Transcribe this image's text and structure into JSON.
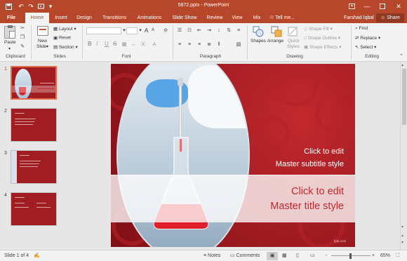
{
  "app": {
    "document_title": "5872.pptx - PowerPoint"
  },
  "tabs": [
    {
      "label": "File"
    },
    {
      "label": "Home"
    },
    {
      "label": "Insert"
    },
    {
      "label": "Design"
    },
    {
      "label": "Transitions"
    },
    {
      "label": "Animations"
    },
    {
      "label": "Slide Show"
    },
    {
      "label": "Review"
    },
    {
      "label": "View"
    },
    {
      "label": "Mix"
    }
  ],
  "tell_me": "Tell me...",
  "user": "Farshad Iqbal",
  "share_label": "Share",
  "ribbon": {
    "clipboard": {
      "paste": "Paste",
      "group": "Clipboard"
    },
    "slides": {
      "new_slide_line1": "New",
      "new_slide_line2": "Slide",
      "layout": "Layout",
      "reset": "Reset",
      "section": "Section",
      "group": "Slides"
    },
    "font": {
      "bold": "B",
      "italic": "I",
      "underline": "U",
      "strike": "S",
      "grow": "A",
      "shrink": "A",
      "group": "Font"
    },
    "paragraph": {
      "group": "Paragraph"
    },
    "drawing": {
      "shapes": "Shapes",
      "arrange": "Arrange",
      "quick_line1": "Quick",
      "quick_line2": "Styles",
      "shape_fill": "Shape Fill",
      "shape_outline": "Shape Outline",
      "shape_effects": "Shape Effects",
      "group": "Drawing"
    },
    "editing": {
      "find": "Find",
      "replace": "Replace",
      "select": "Select",
      "group": "Editing"
    }
  },
  "thumbnails": [
    {
      "number": "1",
      "selected": true
    },
    {
      "number": "2",
      "selected": false
    },
    {
      "number": "3",
      "selected": false
    },
    {
      "number": "4",
      "selected": false
    }
  ],
  "slide": {
    "subtitle_line1": "Click to edit",
    "subtitle_line2": "Master subtitle style",
    "title_line1": "Click to edit",
    "title_line2": "Master title style",
    "watermark": "fppt.com"
  },
  "statusbar": {
    "slide_info": "Slide 1 of 4",
    "notes": "Notes",
    "comments": "Comments",
    "zoom": "65%",
    "minus": "-",
    "plus": "+"
  },
  "colors": {
    "accent": "#b7472a",
    "slide_red": "#a11d22",
    "title_red": "#c0282d"
  }
}
